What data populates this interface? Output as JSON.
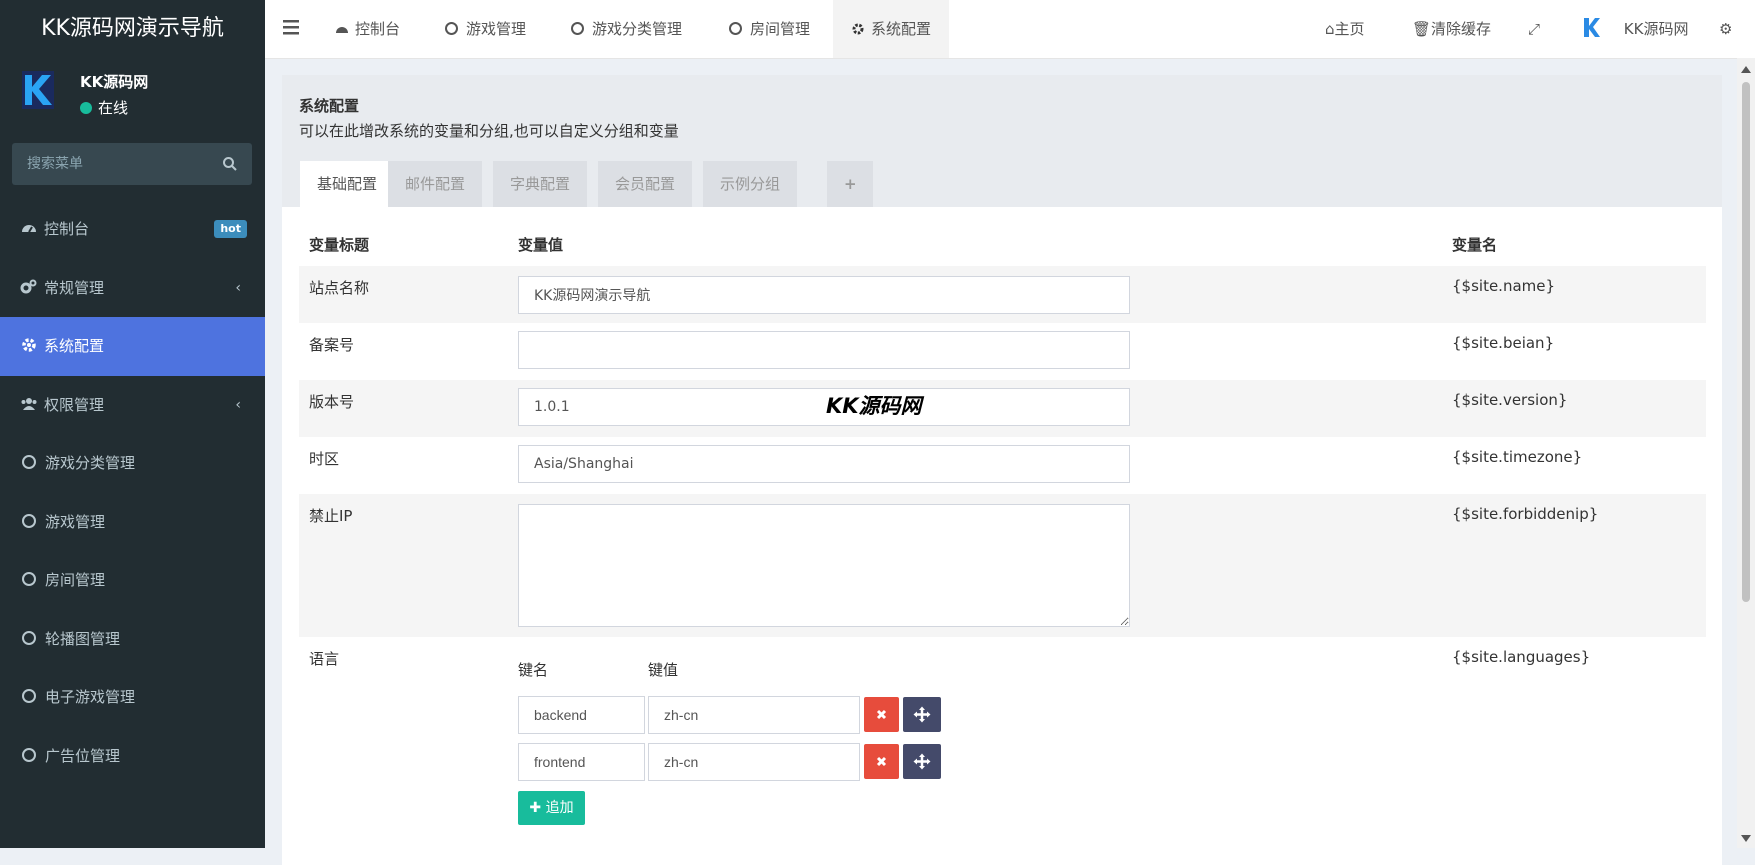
{
  "app": {
    "title": "KK源码网演示导航"
  },
  "user": {
    "name": "KK源码网",
    "status": "在线"
  },
  "sidebar": {
    "search_placeholder": "搜索菜单",
    "items": [
      {
        "label": "控制台",
        "badge": "hot"
      },
      {
        "label": "常规管理"
      },
      {
        "label": "系统配置"
      },
      {
        "label": "权限管理"
      },
      {
        "label": "游戏分类管理"
      },
      {
        "label": "游戏管理"
      },
      {
        "label": "房间管理"
      },
      {
        "label": "轮播图管理"
      },
      {
        "label": "电子游戏管理"
      },
      {
        "label": "广告位管理"
      }
    ]
  },
  "topbar": {
    "tabs": [
      "控制台",
      "游戏管理",
      "游戏分类管理",
      "房间管理",
      "系统配置"
    ],
    "home": "主页",
    "clear_cache": "清除缓存",
    "site_name": "KK源码网"
  },
  "panel": {
    "title": "系统配置",
    "subtitle": "可以在此增改系统的变量和分组,也可以自定义分组和变量",
    "tabs": [
      "基础配置",
      "邮件配置",
      "字典配置",
      "会员配置",
      "示例分组"
    ],
    "add_tab": "+"
  },
  "table": {
    "headers": [
      "变量标题",
      "变量值",
      "变量名"
    ],
    "rows": [
      {
        "label": "站点名称",
        "value": "KK源码网演示导航",
        "var": "{$site.name}"
      },
      {
        "label": "备案号",
        "value": "",
        "var": "{$site.beian}"
      },
      {
        "label": "版本号",
        "value": "1.0.1",
        "var": "{$site.version}"
      },
      {
        "label": "时区",
        "value": "Asia/Shanghai",
        "var": "{$site.timezone}"
      },
      {
        "label": "禁止IP",
        "value": "",
        "var": "{$site.forbiddenip}"
      },
      {
        "label": "语言",
        "var": "{$site.languages}"
      }
    ],
    "languages": {
      "key_header": "键名",
      "value_header": "键值",
      "entries": [
        {
          "key": "backend",
          "value": "zh-cn"
        },
        {
          "key": "frontend",
          "value": "zh-cn"
        }
      ],
      "add_label": "追加"
    }
  },
  "watermark": "KK源码网",
  "colors": {
    "sidebar_bg": "#222d32",
    "active": "#4e73df",
    "danger": "#e74c3c",
    "success": "#18bc9c",
    "dark_btn": "#444a6a"
  }
}
